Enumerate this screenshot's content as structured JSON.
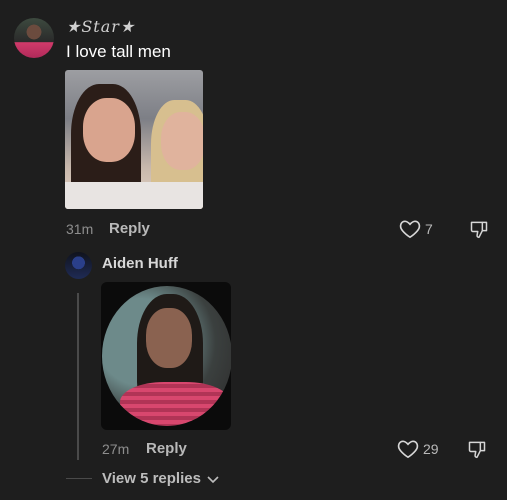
{
  "comment": {
    "username": "★𝑆𝑡𝑎𝑟★",
    "text": "I love tall men",
    "time": "31m",
    "reply_label": "Reply",
    "likes": "7"
  },
  "reply": {
    "username": "Aiden Huff",
    "time": "27m",
    "reply_label": "Reply",
    "likes": "29"
  },
  "thread": {
    "view_replies_label": "View 5 replies"
  },
  "icons": {
    "like": "heart-outline-icon",
    "dislike": "thumbs-down-outline-icon",
    "chevron": "chevron-down-icon"
  }
}
